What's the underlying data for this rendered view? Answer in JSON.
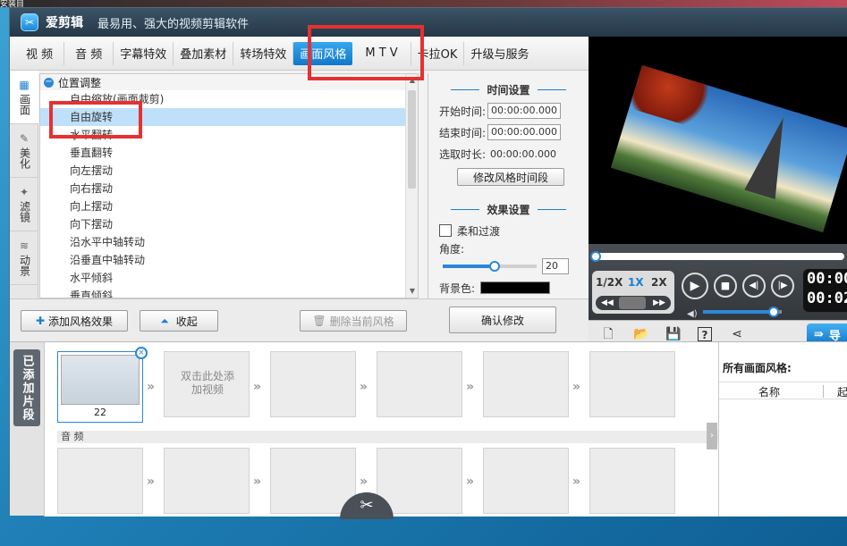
{
  "desktop": {
    "label": "安装目"
  },
  "app": {
    "title": "爱剪辑",
    "subtitle": "最易用、强大的视频剪辑软件"
  },
  "tabs": [
    {
      "label": "视 频",
      "active": false
    },
    {
      "label": "音 频",
      "active": false
    },
    {
      "label": "字幕特效",
      "active": false
    },
    {
      "label": "叠加素材",
      "active": false
    },
    {
      "label": "转场特效",
      "active": false
    },
    {
      "label": "画面风格",
      "active": true
    },
    {
      "label": "M T V",
      "active": false
    },
    {
      "label": "卡拉OK",
      "active": false
    },
    {
      "label": "升级与服务",
      "active": false
    }
  ],
  "side_tabs": [
    {
      "label": "画面",
      "icon": "picture-icon",
      "active": true
    },
    {
      "label": "美化",
      "icon": "wand-icon",
      "active": false
    },
    {
      "label": "滤镜",
      "icon": "sparkle-icon",
      "active": false
    },
    {
      "label": "动景",
      "icon": "waves-icon",
      "active": false
    }
  ],
  "style_list": {
    "group": "位置调整",
    "items": [
      "自由缩放(画面裁剪)",
      "自由旋转",
      "水平翻转",
      "垂直翻转",
      "向左摆动",
      "向右摆动",
      "向上摆动",
      "向下摆动",
      "沿水平中轴转动",
      "沿垂直中轴转动",
      "水平倾斜",
      "垂直倾斜"
    ],
    "selected_index": 1
  },
  "settings": {
    "time_title": "时间设置",
    "start_label": "开始时间:",
    "start_value": "00:00:00.000",
    "end_label": "结束时间:",
    "end_value": "00:00:00.000",
    "duration_label": "选取时长:",
    "duration_value": "00:00:00.000",
    "modify_time_button": "修改风格时间段",
    "effect_title": "效果设置",
    "soft_transition_label": "柔和过渡",
    "soft_transition_checked": false,
    "angle_label": "角度:",
    "angle_value": "20",
    "angle_fraction": 0.55,
    "bg_color_label": "背景色:",
    "bg_color": "#000000",
    "confirm_button": "确认修改"
  },
  "actions": {
    "add_style": "添加风格效果",
    "collapse": "收起",
    "delete_style": "删除当前风格"
  },
  "player": {
    "speeds": [
      "1/2X",
      "1X",
      "2X"
    ],
    "active_speed": "1X",
    "time_top": "00:00",
    "time_bottom": "00:02",
    "volume_fraction": 0.9,
    "export_label": "导"
  },
  "timeline": {
    "added_tab": "已添加片段",
    "first_clip_label": "22",
    "placeholder": "双击此处添加视频",
    "audio_label": "音 频"
  },
  "styles_panel": {
    "title": "所有画面风格:",
    "col_name": "名称",
    "col_start": "起"
  },
  "colors": {
    "accent": "#1a7fd0",
    "highlight": "#e53131",
    "selection": "#bfe0fb"
  }
}
